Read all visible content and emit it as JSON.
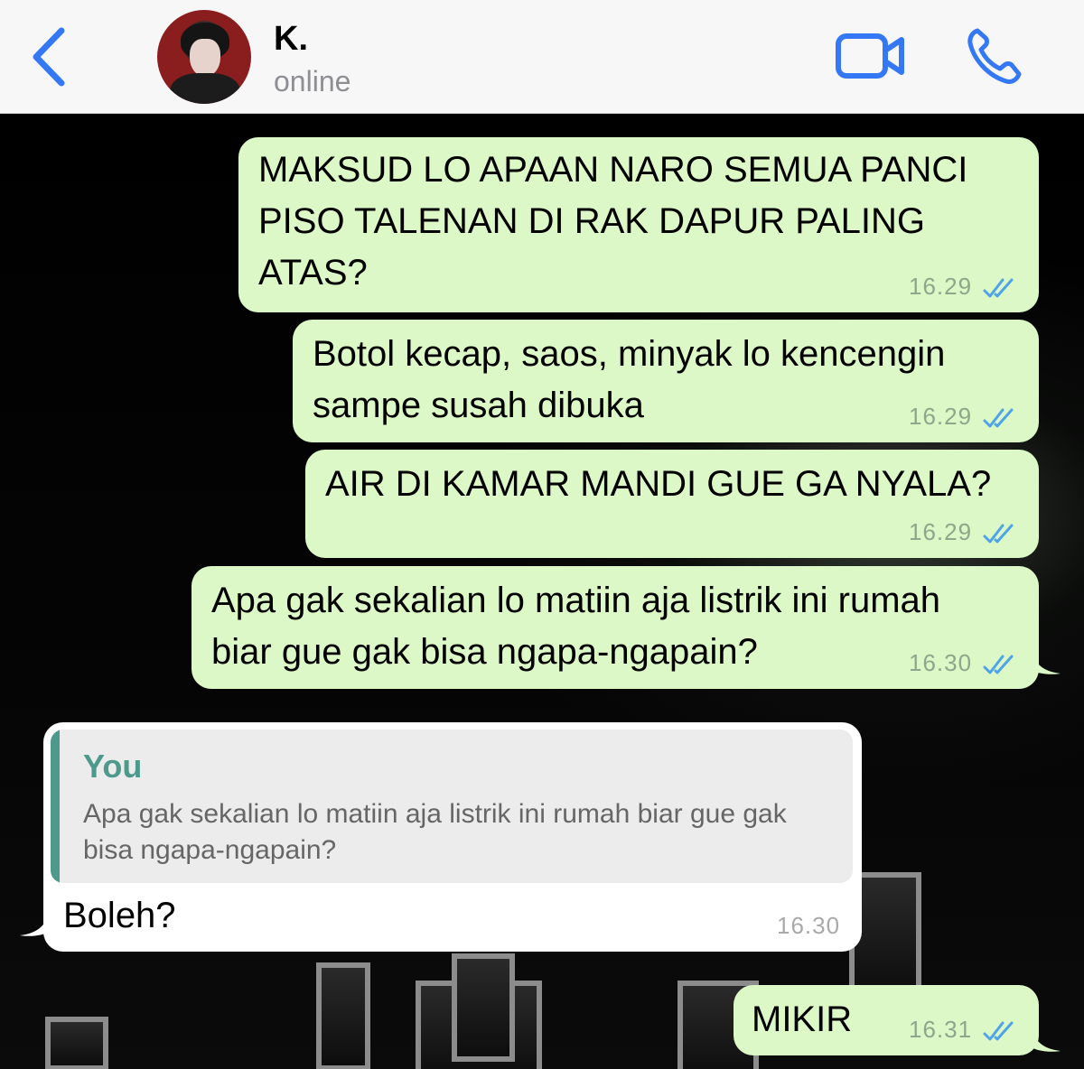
{
  "header": {
    "back_icon": "chevron-left-icon",
    "contact_name": "K.",
    "contact_status": "online",
    "video_icon": "video-camera-icon",
    "call_icon": "phone-icon",
    "accent_color": "#3478f6"
  },
  "messages": [
    {
      "direction": "outgoing",
      "text": "MAKSUD LO APAAN NARO SEMUA PANCI\nPISO TALENAN DI RAK DAPUR PALING\nATAS?",
      "time": "16.29",
      "status": "read"
    },
    {
      "direction": "outgoing",
      "text": "Botol kecap, saos, minyak lo kencengin\nsampe susah dibuka",
      "time": "16.29",
      "status": "read"
    },
    {
      "direction": "outgoing",
      "text": "AIR DI KAMAR MANDI GUE GA NYALA?",
      "time": "16.29",
      "status": "read"
    },
    {
      "direction": "outgoing",
      "text": "Apa gak sekalian lo matiin aja listrik ini rumah\nbiar gue gak bisa ngapa-ngapain?",
      "time": "16.30",
      "status": "read"
    },
    {
      "direction": "incoming",
      "reply_to": {
        "author": "You",
        "text": "Apa gak sekalian lo matiin aja listrik ini rumah biar gue gak bisa ngapa-ngapain?"
      },
      "text": "Boleh?",
      "time": "16.30"
    },
    {
      "direction": "outgoing",
      "text": "MIKIR",
      "time": "16.31",
      "status": "read"
    }
  ],
  "colors": {
    "outgoing_bubble": "#dcf8c6",
    "incoming_bubble": "#ffffff",
    "quote_accent": "#4d9a8c",
    "read_ticks": "#4fa3e8"
  }
}
